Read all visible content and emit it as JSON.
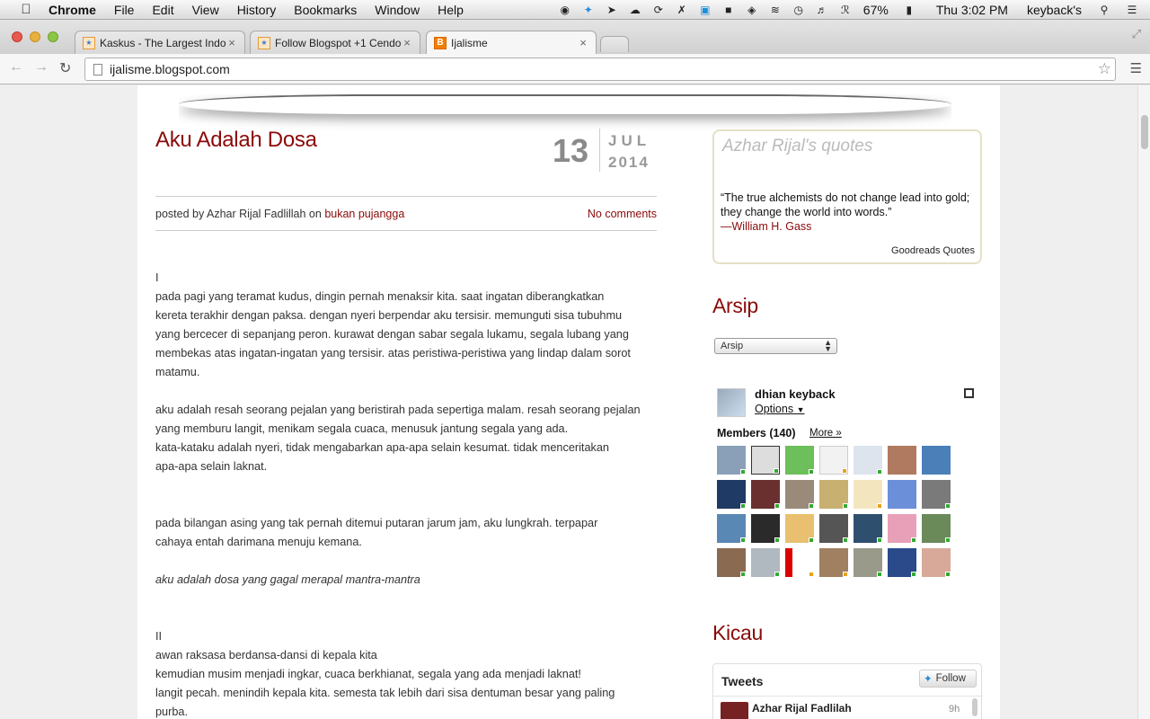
{
  "menubar": {
    "app": "Chrome",
    "items": [
      "File",
      "Edit",
      "View",
      "History",
      "Bookmarks",
      "Window",
      "Help"
    ],
    "battery": "67%",
    "clock": "Thu 3:02 PM",
    "user": "keyback's"
  },
  "tabs": [
    {
      "title": "Kaskus - The Largest Indo",
      "close": "×"
    },
    {
      "title": "Follow Blogspot +1 Cendo",
      "close": "×"
    },
    {
      "title": "Ijalisme",
      "close": "×"
    }
  ],
  "omnibox": {
    "url": "ijalisme.blogspot.com"
  },
  "post": {
    "title": "Aku Adalah Dosa",
    "date_day": "13",
    "date_month": "JUL",
    "date_year": "2014",
    "meta_prefix": "posted by Azhar Rijal Fadlillah on",
    "label": "bukan pujangga",
    "comments": "No comments",
    "lines": [
      "I",
      "pada pagi yang teramat kudus, dingin pernah menaksir kita. saat ingatan diberangkatkan",
      "kereta terakhir dengan paksa. dengan nyeri berpendar aku tersisir. memunguti sisa tubuhmu",
      "yang bercecer di sepanjang peron. kurawat dengan sabar segala lukamu, segala lubang yang",
      "membekas atas ingatan-ingatan yang tersisir. atas peristiwa-peristiwa yang lindap dalam sorot",
      "matamu.",
      "",
      "aku adalah resah seorang pejalan yang beristirah pada sepertiga malam. resah seorang pejalan",
      "yang memburu langit, menikam segala cuaca, menusuk jantung segala yang ada.",
      "kata-kataku adalah nyeri, tidak mengabarkan apa-apa selain kesumat. tidak menceritakan",
      "apa-apa selain laknat.",
      "",
      "",
      "pada bilangan asing yang tak pernah ditemui putaran jarum jam, aku lungkrah. terpapar",
      "cahaya entah darimana menuju kemana.",
      "",
      "aku adalah dosa yang gagal merapal mantra-mantra",
      "",
      "",
      "II",
      "awan raksasa berdansa-dansi di kepala kita",
      "kemudian musim menjadi ingkar, cuaca berkhianat, segala yang ada menjadi laknat!",
      "langit pecah. menindih kepala kita. semesta tak lebih dari sisa dentuman besar yang paling",
      "purba."
    ]
  },
  "quotes": {
    "title": "Azhar Rijal's quotes",
    "text": "“The true alchemists do not change lead into gold; they change the world into words.”",
    "author": "—William H. Gass",
    "source": "Goodreads Quotes"
  },
  "arsip": {
    "title": "Arsip",
    "selected": "Arsip"
  },
  "gfc": {
    "name": "dhian keyback",
    "options": "Options",
    "members": "Members (140)",
    "more": "More »"
  },
  "kicau": {
    "title": "Kicau",
    "widget_title": "Tweets",
    "follow": "Follow",
    "user": "Azhar Rijal Fadlilah",
    "time": "9h"
  }
}
